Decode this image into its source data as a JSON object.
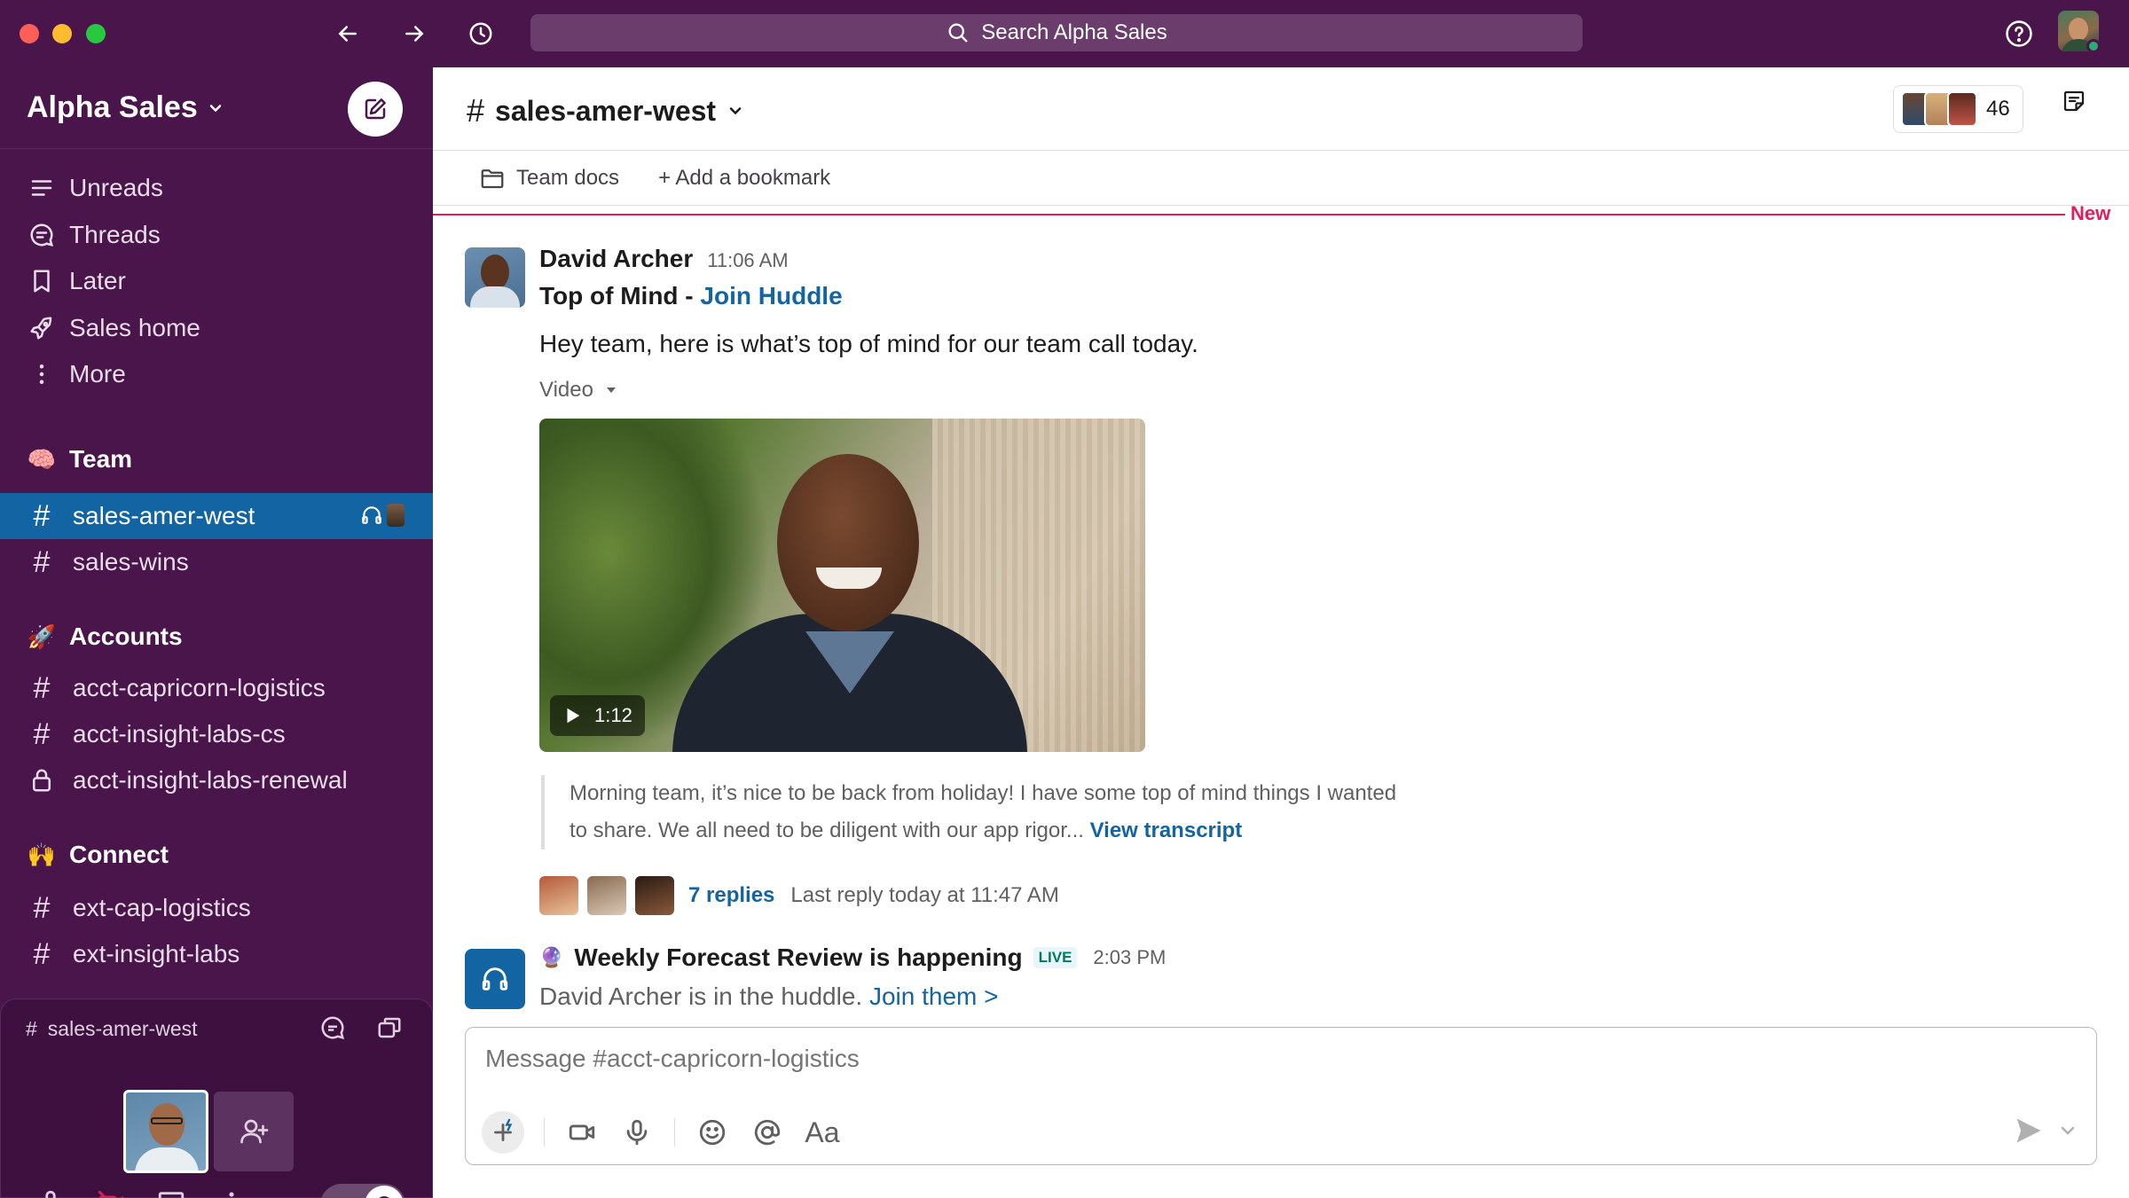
{
  "app": {
    "search_placeholder": "Search Alpha Sales",
    "accent": "#4a154b",
    "active_color": "#1264a3",
    "new_divider_color": "#e01e5a"
  },
  "sidebar": {
    "workspace_name": "Alpha Sales",
    "nav": [
      {
        "label": "Unreads",
        "icon": "unreads-icon"
      },
      {
        "label": "Threads",
        "icon": "threads-icon"
      },
      {
        "label": "Later",
        "icon": "bookmark-icon"
      },
      {
        "label": "Sales home",
        "icon": "rocket-icon"
      },
      {
        "label": "More",
        "icon": "more-vertical-icon"
      }
    ],
    "sections": {
      "team": {
        "emoji": "🧠",
        "label": "Team",
        "channels": [
          "sales-amer-west",
          "sales-wins"
        ]
      },
      "accounts": {
        "emoji": "🚀",
        "label": "Accounts",
        "channels": [
          "acct-capricorn-logistics",
          "acct-insight-labs-cs",
          "acct-insight-labs-renewal"
        ]
      },
      "connect": {
        "emoji": "🙌",
        "label": "Connect",
        "channels": [
          "ext-cap-logistics",
          "ext-insight-labs"
        ]
      }
    },
    "huddle": {
      "channel": "sales-amer-west",
      "hash": "#"
    }
  },
  "channel": {
    "name": "sales-amer-west",
    "hash": "#",
    "member_count": "46",
    "bookmarks": [
      "Team docs",
      "+ Add a bookmark"
    ],
    "new_label": "New"
  },
  "messages": {
    "first": {
      "author": "David Archer",
      "time": "11:06 AM",
      "subhead_prefix": "Top of Mind - ",
      "subhead_link": "Join Huddle",
      "body": "Hey team, here is what’s top of mind for our team call today.",
      "video_label": "Video",
      "video_duration": "1:12",
      "transcript_text": "Morning team, it’s nice to be back from holiday! I have some top of mind things I wanted to share. We all need to be diligent with our app rigor... ",
      "transcript_link": "View transcript",
      "reply_count": "7 replies",
      "last_reply": "Last reply today at 11:47 AM"
    },
    "huddle": {
      "emoji": "🔮",
      "title": "Weekly Forecast Review is happening",
      "badge": "LIVE",
      "time": "2:03 PM",
      "body_prefix": "David Archer is in the huddle. ",
      "body_link": "Join them >"
    }
  },
  "composer": {
    "placeholder": "Message #acct-capricorn-logistics",
    "format_label": "Aa"
  }
}
